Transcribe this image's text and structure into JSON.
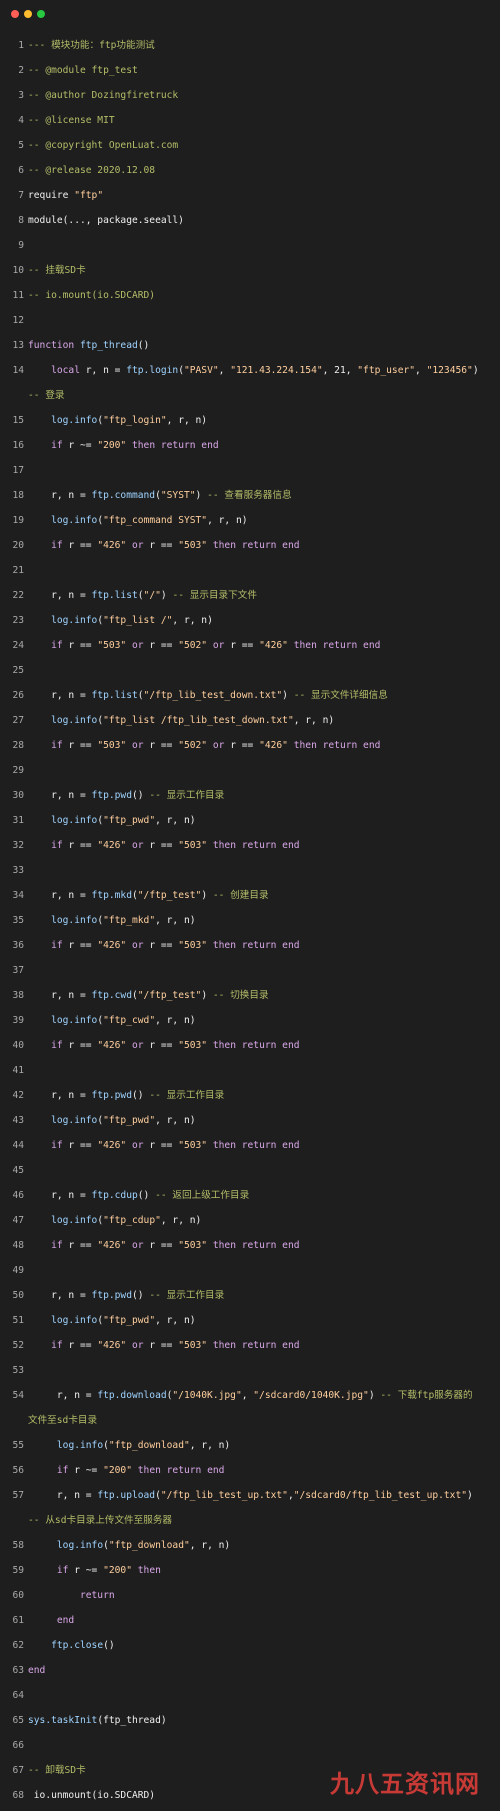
{
  "window": {
    "controls": [
      "close",
      "minimize",
      "maximize"
    ]
  },
  "watermark": "九八五资讯网",
  "colors": {
    "background": "#1e1e1e",
    "line_number": "#a9a9a9",
    "comment": "#b5bd68",
    "string": "#ffcf9e",
    "keyword": "#d9a7e8",
    "function": "#9fd3ff",
    "plain": "#f0f0f0"
  },
  "lines": [
    {
      "n": "1",
      "tokens": [
        [
          "comment",
          "--- 模块功能：ftp功能测试"
        ]
      ]
    },
    {
      "n": "2",
      "tokens": [
        [
          "comment",
          "-- @module ftp_test"
        ]
      ]
    },
    {
      "n": "3",
      "tokens": [
        [
          "comment",
          "-- @author Dozingfiretruck"
        ]
      ]
    },
    {
      "n": "4",
      "tokens": [
        [
          "comment",
          "-- @license MIT"
        ]
      ]
    },
    {
      "n": "5",
      "tokens": [
        [
          "comment",
          "-- @copyright OpenLuat.com"
        ]
      ]
    },
    {
      "n": "6",
      "tokens": [
        [
          "comment",
          "-- @release 2020.12.08"
        ]
      ]
    },
    {
      "n": "7",
      "tokens": [
        [
          "plain",
          "require "
        ],
        [
          "string",
          "\"ftp\""
        ]
      ]
    },
    {
      "n": "8",
      "tokens": [
        [
          "plain",
          "module(..., package.seeall)"
        ]
      ]
    },
    {
      "n": "9",
      "tokens": []
    },
    {
      "n": "10",
      "tokens": [
        [
          "comment",
          "-- 挂载SD卡"
        ]
      ]
    },
    {
      "n": "11",
      "tokens": [
        [
          "comment",
          "-- io.mount(io.SDCARD)"
        ]
      ]
    },
    {
      "n": "12",
      "tokens": []
    },
    {
      "n": "13",
      "tokens": [
        [
          "keyword",
          "function "
        ],
        [
          "func",
          "ftp_thread"
        ],
        [
          "plain",
          "()"
        ]
      ]
    },
    {
      "n": "14",
      "tokens": [
        [
          "plain",
          "    "
        ],
        [
          "keyword",
          "local"
        ],
        [
          "plain",
          " r, n = "
        ],
        [
          "func",
          "ftp.login"
        ],
        [
          "plain",
          "("
        ],
        [
          "string",
          "\"PASV\""
        ],
        [
          "plain",
          ", "
        ],
        [
          "string",
          "\"121.43.224.154\""
        ],
        [
          "plain",
          ", 21, "
        ],
        [
          "string",
          "\"ftp_user\""
        ],
        [
          "plain",
          ", "
        ],
        [
          "string",
          "\"123456\""
        ],
        [
          "plain",
          ")"
        ]
      ],
      "cont": [
        [
          "comment",
          "-- 登录"
        ]
      ]
    },
    {
      "n": "15",
      "tokens": [
        [
          "plain",
          "    "
        ],
        [
          "func",
          "log.info"
        ],
        [
          "plain",
          "("
        ],
        [
          "string",
          "\"ftp_login\""
        ],
        [
          "plain",
          ", r, n)"
        ]
      ]
    },
    {
      "n": "16",
      "tokens": [
        [
          "plain",
          "    "
        ],
        [
          "keyword",
          "if"
        ],
        [
          "plain",
          " r ~= "
        ],
        [
          "string",
          "\"200\""
        ],
        [
          "keyword",
          " then return end"
        ]
      ]
    },
    {
      "n": "17",
      "tokens": []
    },
    {
      "n": "18",
      "tokens": [
        [
          "plain",
          "    r, n = "
        ],
        [
          "func",
          "ftp.command"
        ],
        [
          "plain",
          "("
        ],
        [
          "string",
          "\"SYST\""
        ],
        [
          "plain",
          ") "
        ],
        [
          "comment",
          "-- 查看服务器信息"
        ]
      ]
    },
    {
      "n": "19",
      "tokens": [
        [
          "plain",
          "    "
        ],
        [
          "func",
          "log.info"
        ],
        [
          "plain",
          "("
        ],
        [
          "string",
          "\"ftp_command SYST\""
        ],
        [
          "plain",
          ", r, n)"
        ]
      ]
    },
    {
      "n": "20",
      "tokens": [
        [
          "plain",
          "    "
        ],
        [
          "keyword",
          "if"
        ],
        [
          "plain",
          " r == "
        ],
        [
          "string",
          "\"426\""
        ],
        [
          "keyword",
          " or"
        ],
        [
          "plain",
          " r == "
        ],
        [
          "string",
          "\"503\""
        ],
        [
          "keyword",
          " then return end"
        ]
      ]
    },
    {
      "n": "21",
      "tokens": []
    },
    {
      "n": "22",
      "tokens": [
        [
          "plain",
          "    r, n = "
        ],
        [
          "func",
          "ftp.list"
        ],
        [
          "plain",
          "("
        ],
        [
          "string",
          "\"/\""
        ],
        [
          "plain",
          ") "
        ],
        [
          "comment",
          "-- 显示目录下文件"
        ]
      ]
    },
    {
      "n": "23",
      "tokens": [
        [
          "plain",
          "    "
        ],
        [
          "func",
          "log.info"
        ],
        [
          "plain",
          "("
        ],
        [
          "string",
          "\"ftp_list /\""
        ],
        [
          "plain",
          ", r, n)"
        ]
      ]
    },
    {
      "n": "24",
      "tokens": [
        [
          "plain",
          "    "
        ],
        [
          "keyword",
          "if"
        ],
        [
          "plain",
          " r == "
        ],
        [
          "string",
          "\"503\""
        ],
        [
          "keyword",
          " or"
        ],
        [
          "plain",
          " r == "
        ],
        [
          "string",
          "\"502\""
        ],
        [
          "keyword",
          " or"
        ],
        [
          "plain",
          " r == "
        ],
        [
          "string",
          "\"426\""
        ],
        [
          "keyword",
          " then return end"
        ]
      ]
    },
    {
      "n": "25",
      "tokens": []
    },
    {
      "n": "26",
      "tokens": [
        [
          "plain",
          "    r, n = "
        ],
        [
          "func",
          "ftp.list"
        ],
        [
          "plain",
          "("
        ],
        [
          "string",
          "\"/ftp_lib_test_down.txt\""
        ],
        [
          "plain",
          ") "
        ],
        [
          "comment",
          "-- 显示文件详细信息"
        ]
      ]
    },
    {
      "n": "27",
      "tokens": [
        [
          "plain",
          "    "
        ],
        [
          "func",
          "log.info"
        ],
        [
          "plain",
          "("
        ],
        [
          "string",
          "\"ftp_list /ftp_lib_test_down.txt\""
        ],
        [
          "plain",
          ", r, n)"
        ]
      ]
    },
    {
      "n": "28",
      "tokens": [
        [
          "plain",
          "    "
        ],
        [
          "keyword",
          "if"
        ],
        [
          "plain",
          " r == "
        ],
        [
          "string",
          "\"503\""
        ],
        [
          "keyword",
          " or"
        ],
        [
          "plain",
          " r == "
        ],
        [
          "string",
          "\"502\""
        ],
        [
          "keyword",
          " or"
        ],
        [
          "plain",
          " r == "
        ],
        [
          "string",
          "\"426\""
        ],
        [
          "keyword",
          " then return end"
        ]
      ]
    },
    {
      "n": "29",
      "tokens": []
    },
    {
      "n": "30",
      "tokens": [
        [
          "plain",
          "    r, n = "
        ],
        [
          "func",
          "ftp.pwd"
        ],
        [
          "plain",
          "() "
        ],
        [
          "comment",
          "-- 显示工作目录"
        ]
      ]
    },
    {
      "n": "31",
      "tokens": [
        [
          "plain",
          "    "
        ],
        [
          "func",
          "log.info"
        ],
        [
          "plain",
          "("
        ],
        [
          "string",
          "\"ftp_pwd\""
        ],
        [
          "plain",
          ", r, n)"
        ]
      ]
    },
    {
      "n": "32",
      "tokens": [
        [
          "plain",
          "    "
        ],
        [
          "keyword",
          "if"
        ],
        [
          "plain",
          " r == "
        ],
        [
          "string",
          "\"426\""
        ],
        [
          "keyword",
          " or"
        ],
        [
          "plain",
          " r == "
        ],
        [
          "string",
          "\"503\""
        ],
        [
          "keyword",
          " then return end"
        ]
      ]
    },
    {
      "n": "33",
      "tokens": []
    },
    {
      "n": "34",
      "tokens": [
        [
          "plain",
          "    r, n = "
        ],
        [
          "func",
          "ftp.mkd"
        ],
        [
          "plain",
          "("
        ],
        [
          "string",
          "\"/ftp_test\""
        ],
        [
          "plain",
          ") "
        ],
        [
          "comment",
          "-- 创建目录"
        ]
      ]
    },
    {
      "n": "35",
      "tokens": [
        [
          "plain",
          "    "
        ],
        [
          "func",
          "log.info"
        ],
        [
          "plain",
          "("
        ],
        [
          "string",
          "\"ftp_mkd\""
        ],
        [
          "plain",
          ", r, n)"
        ]
      ]
    },
    {
      "n": "36",
      "tokens": [
        [
          "plain",
          "    "
        ],
        [
          "keyword",
          "if"
        ],
        [
          "plain",
          " r == "
        ],
        [
          "string",
          "\"426\""
        ],
        [
          "keyword",
          " or"
        ],
        [
          "plain",
          " r == "
        ],
        [
          "string",
          "\"503\""
        ],
        [
          "keyword",
          " then return end"
        ]
      ]
    },
    {
      "n": "37",
      "tokens": []
    },
    {
      "n": "38",
      "tokens": [
        [
          "plain",
          "    r, n = "
        ],
        [
          "func",
          "ftp.cwd"
        ],
        [
          "plain",
          "("
        ],
        [
          "string",
          "\"/ftp_test\""
        ],
        [
          "plain",
          ") "
        ],
        [
          "comment",
          "-- 切换目录"
        ]
      ]
    },
    {
      "n": "39",
      "tokens": [
        [
          "plain",
          "    "
        ],
        [
          "func",
          "log.info"
        ],
        [
          "plain",
          "("
        ],
        [
          "string",
          "\"ftp_cwd\""
        ],
        [
          "plain",
          ", r, n)"
        ]
      ]
    },
    {
      "n": "40",
      "tokens": [
        [
          "plain",
          "    "
        ],
        [
          "keyword",
          "if"
        ],
        [
          "plain",
          " r == "
        ],
        [
          "string",
          "\"426\""
        ],
        [
          "keyword",
          " or"
        ],
        [
          "plain",
          " r == "
        ],
        [
          "string",
          "\"503\""
        ],
        [
          "keyword",
          " then return end"
        ]
      ]
    },
    {
      "n": "41",
      "tokens": []
    },
    {
      "n": "42",
      "tokens": [
        [
          "plain",
          "    r, n = "
        ],
        [
          "func",
          "ftp.pwd"
        ],
        [
          "plain",
          "() "
        ],
        [
          "comment",
          "-- 显示工作目录"
        ]
      ]
    },
    {
      "n": "43",
      "tokens": [
        [
          "plain",
          "    "
        ],
        [
          "func",
          "log.info"
        ],
        [
          "plain",
          "("
        ],
        [
          "string",
          "\"ftp_pwd\""
        ],
        [
          "plain",
          ", r, n)"
        ]
      ]
    },
    {
      "n": "44",
      "tokens": [
        [
          "plain",
          "    "
        ],
        [
          "keyword",
          "if"
        ],
        [
          "plain",
          " r == "
        ],
        [
          "string",
          "\"426\""
        ],
        [
          "keyword",
          " or"
        ],
        [
          "plain",
          " r == "
        ],
        [
          "string",
          "\"503\""
        ],
        [
          "keyword",
          " then return end"
        ]
      ]
    },
    {
      "n": "45",
      "tokens": []
    },
    {
      "n": "46",
      "tokens": [
        [
          "plain",
          "    r, n = "
        ],
        [
          "func",
          "ftp.cdup"
        ],
        [
          "plain",
          "() "
        ],
        [
          "comment",
          "-- 返回上级工作目录"
        ]
      ]
    },
    {
      "n": "47",
      "tokens": [
        [
          "plain",
          "    "
        ],
        [
          "func",
          "log.info"
        ],
        [
          "plain",
          "("
        ],
        [
          "string",
          "\"ftp_cdup\""
        ],
        [
          "plain",
          ", r, n)"
        ]
      ]
    },
    {
      "n": "48",
      "tokens": [
        [
          "plain",
          "    "
        ],
        [
          "keyword",
          "if"
        ],
        [
          "plain",
          " r == "
        ],
        [
          "string",
          "\"426\""
        ],
        [
          "keyword",
          " or"
        ],
        [
          "plain",
          " r == "
        ],
        [
          "string",
          "\"503\""
        ],
        [
          "keyword",
          " then return end"
        ]
      ]
    },
    {
      "n": "49",
      "tokens": []
    },
    {
      "n": "50",
      "tokens": [
        [
          "plain",
          "    r, n = "
        ],
        [
          "func",
          "ftp.pwd"
        ],
        [
          "plain",
          "() "
        ],
        [
          "comment",
          "-- 显示工作目录"
        ]
      ]
    },
    {
      "n": "51",
      "tokens": [
        [
          "plain",
          "    "
        ],
        [
          "func",
          "log.info"
        ],
        [
          "plain",
          "("
        ],
        [
          "string",
          "\"ftp_pwd\""
        ],
        [
          "plain",
          ", r, n)"
        ]
      ]
    },
    {
      "n": "52",
      "tokens": [
        [
          "plain",
          "    "
        ],
        [
          "keyword",
          "if"
        ],
        [
          "plain",
          " r == "
        ],
        [
          "string",
          "\"426\""
        ],
        [
          "keyword",
          " or"
        ],
        [
          "plain",
          " r == "
        ],
        [
          "string",
          "\"503\""
        ],
        [
          "keyword",
          " then return end"
        ]
      ]
    },
    {
      "n": "53",
      "tokens": []
    },
    {
      "n": "54",
      "tokens": [
        [
          "plain",
          "     r, n = "
        ],
        [
          "func",
          "ftp.download"
        ],
        [
          "plain",
          "("
        ],
        [
          "string",
          "\"/1040K.jpg\""
        ],
        [
          "plain",
          ", "
        ],
        [
          "string",
          "\"/sdcard0/1040K.jpg\""
        ],
        [
          "plain",
          ") "
        ],
        [
          "comment",
          "-- 下载ftp服务器的"
        ]
      ],
      "cont": [
        [
          "comment",
          "文件至sd卡目录"
        ]
      ]
    },
    {
      "n": "55",
      "tokens": [
        [
          "plain",
          "     "
        ],
        [
          "func",
          "log.info"
        ],
        [
          "plain",
          "("
        ],
        [
          "string",
          "\"ftp_download\""
        ],
        [
          "plain",
          ", r, n)"
        ]
      ]
    },
    {
      "n": "56",
      "tokens": [
        [
          "plain",
          "     "
        ],
        [
          "keyword",
          "if"
        ],
        [
          "plain",
          " r ~= "
        ],
        [
          "string",
          "\"200\""
        ],
        [
          "keyword",
          " then return end"
        ]
      ]
    },
    {
      "n": "57",
      "tokens": [
        [
          "plain",
          "     r, n = "
        ],
        [
          "func",
          "ftp.upload"
        ],
        [
          "plain",
          "("
        ],
        [
          "string",
          "\"/ftp_lib_test_up.txt\""
        ],
        [
          "plain",
          ","
        ],
        [
          "string",
          "\"/sdcard0/ftp_lib_test_up.txt\""
        ],
        [
          "plain",
          ")"
        ]
      ],
      "cont": [
        [
          "comment",
          "-- 从sd卡目录上传文件至服务器"
        ]
      ]
    },
    {
      "n": "58",
      "tokens": [
        [
          "plain",
          "     "
        ],
        [
          "func",
          "log.info"
        ],
        [
          "plain",
          "("
        ],
        [
          "string",
          "\"ftp_download\""
        ],
        [
          "plain",
          ", r, n)"
        ]
      ]
    },
    {
      "n": "59",
      "tokens": [
        [
          "plain",
          "     "
        ],
        [
          "keyword",
          "if"
        ],
        [
          "plain",
          " r ~= "
        ],
        [
          "string",
          "\"200\""
        ],
        [
          "keyword",
          " then"
        ]
      ]
    },
    {
      "n": "60",
      "tokens": [
        [
          "keyword",
          "         return"
        ]
      ]
    },
    {
      "n": "61",
      "tokens": [
        [
          "keyword",
          "     end"
        ]
      ]
    },
    {
      "n": "62",
      "tokens": [
        [
          "plain",
          "    "
        ],
        [
          "func",
          "ftp.close"
        ],
        [
          "plain",
          "()"
        ]
      ]
    },
    {
      "n": "63",
      "tokens": [
        [
          "keyword",
          "end"
        ]
      ]
    },
    {
      "n": "64",
      "tokens": []
    },
    {
      "n": "65",
      "tokens": [
        [
          "func",
          "sys.taskInit"
        ],
        [
          "plain",
          "(ftp_thread)"
        ]
      ]
    },
    {
      "n": "66",
      "tokens": []
    },
    {
      "n": "67",
      "tokens": [
        [
          "comment",
          "-- 卸载SD卡"
        ]
      ]
    },
    {
      "n": "68",
      "tokens": [
        [
          "plain",
          " io.unmount(io.SDCARD)"
        ]
      ]
    }
  ]
}
